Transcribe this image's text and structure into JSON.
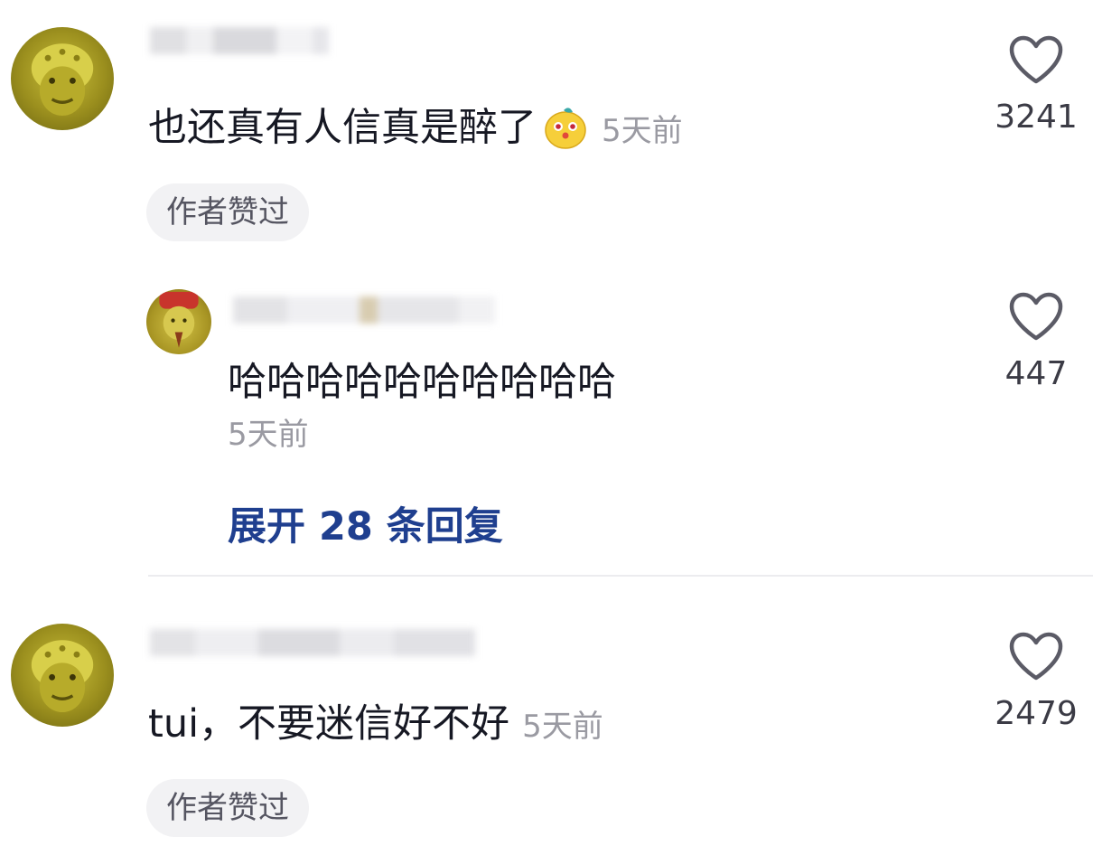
{
  "comments": [
    {
      "text": "也还真有人信真是醉了",
      "emoji": "emoji-face",
      "time": "5天前",
      "badge": "作者赞过",
      "likes": "3241",
      "replies": [
        {
          "text": "哈哈哈哈哈哈哈哈哈哈",
          "time": "5天前",
          "likes": "447"
        }
      ],
      "expand_label": "展开 28 条回复"
    },
    {
      "text": "tui，不要迷信好不好",
      "time": "5天前",
      "badge": "作者赞过",
      "likes": "2479"
    }
  ],
  "icons": {
    "like": "heart-outline-icon",
    "avatar": "golden-figure-avatar"
  },
  "colors": {
    "text": "#161823",
    "muted": "#9a9aa2",
    "link": "#1f3f8f",
    "badge_bg": "#f2f2f4"
  }
}
